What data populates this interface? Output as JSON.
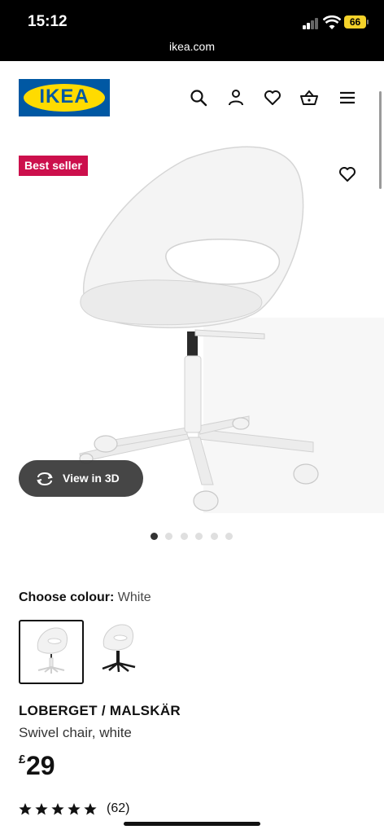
{
  "status_bar": {
    "time": "15:12",
    "battery": "66",
    "url": "ikea.com"
  },
  "brand": {
    "logo_text": "IKEA",
    "blue": "#0058a3",
    "yellow": "#ffdb00"
  },
  "header": {
    "icons": [
      "search-icon",
      "account-icon",
      "favourites-icon",
      "basket-icon",
      "menu-icon"
    ]
  },
  "product": {
    "badge": "Best seller",
    "badge_color": "#cc0f4c",
    "view_3d_label": "View in 3D",
    "image_count": 6,
    "active_image_index": 0,
    "colour_label": "Choose colour:",
    "colour_value": "White",
    "swatches": [
      {
        "name": "White",
        "selected": true
      },
      {
        "name": "Black base",
        "selected": false
      }
    ],
    "name": "LOBERGET / MALSKÄR",
    "description": "Swivel chair, white",
    "price_currency": "£",
    "price": "29",
    "rating_stars": 5,
    "review_count": "(62)"
  }
}
